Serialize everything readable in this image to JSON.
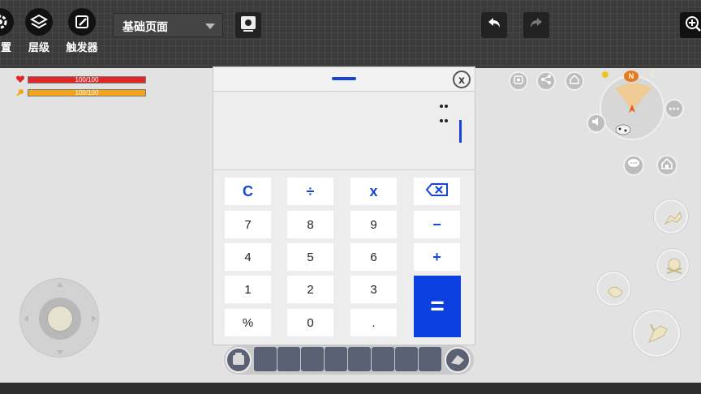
{
  "toolbar": {
    "settings_label": "置",
    "layers_label": "层级",
    "triggers_label": "触发器",
    "page_select_value": "基础页面"
  },
  "hud": {
    "health": {
      "label": "100/100",
      "fraction": 1.0,
      "color": "#e02626"
    },
    "hunger": {
      "label": "100/100",
      "fraction": 1.0,
      "color": "#f2a516"
    }
  },
  "calculator": {
    "keys": {
      "clear": "C",
      "divide": "÷",
      "multiply": "x",
      "seven": "7",
      "eight": "8",
      "nine": "9",
      "minus": "−",
      "four": "4",
      "five": "5",
      "six": "6",
      "plus": "+",
      "one": "1",
      "two": "2",
      "three": "3",
      "equals": "=",
      "percent": "%",
      "zero": "0",
      "dot": "."
    },
    "close_label": "x",
    "accent": "#1646d8"
  },
  "compass": {
    "north_label": "N"
  },
  "icons": [
    "gear-icon",
    "layers-icon",
    "trigger-icon",
    "camera-icon",
    "undo-icon",
    "redo-icon",
    "zoom-in-icon",
    "backspace-icon",
    "chat-icon",
    "home-icon",
    "share-icon",
    "speaker-icon",
    "more-icon",
    "jump-icon",
    "attack-icon",
    "sun-icon",
    "moon-icon"
  ]
}
